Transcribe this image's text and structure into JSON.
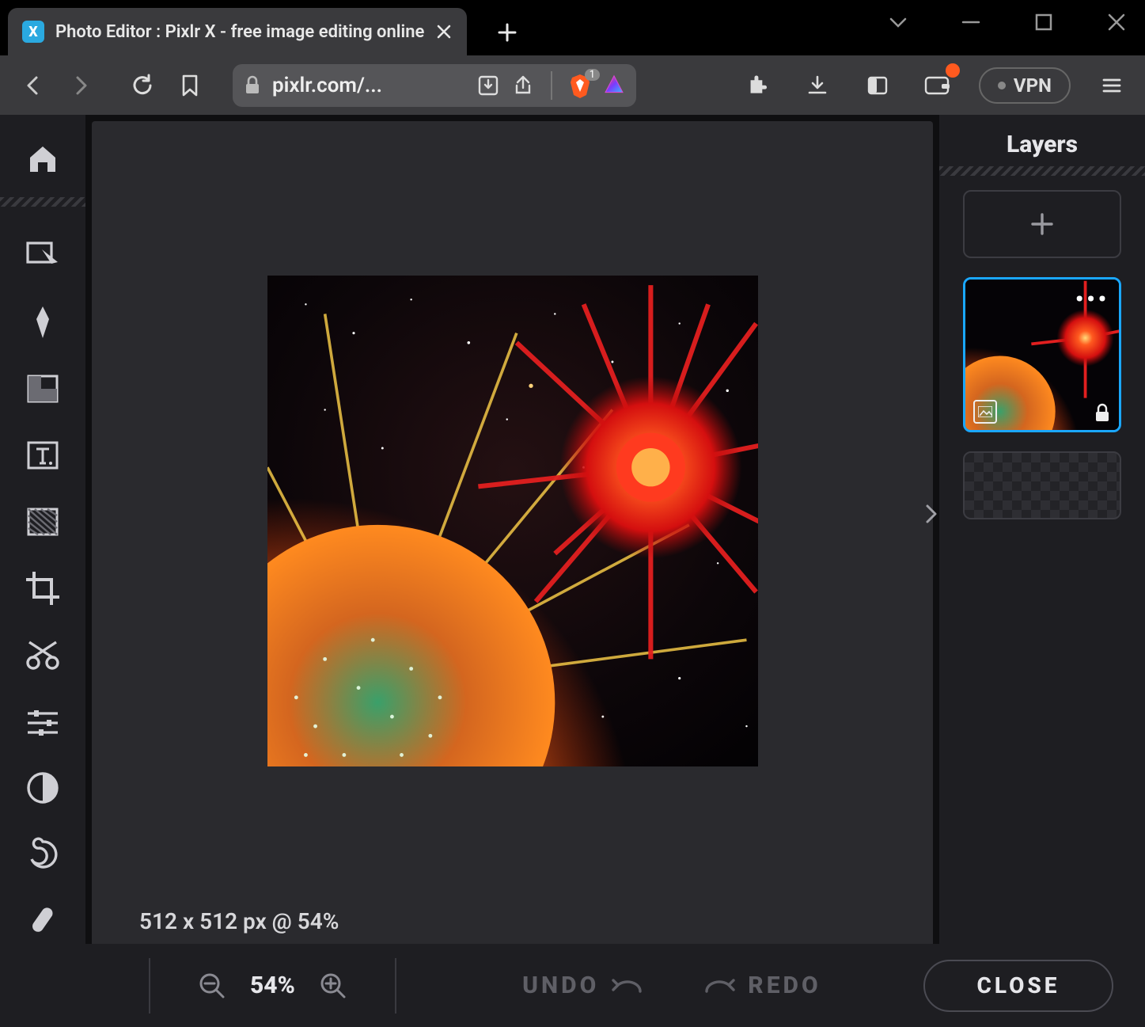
{
  "browser": {
    "tab_title": "Photo Editor : Pixlr X - free image editing online",
    "url_display": "pixlr.com/...",
    "vpn_label": "VPN",
    "brave_badge": "1"
  },
  "app": {
    "layers_title": "Layers",
    "status_text": "512 x 512 px @ 54%"
  },
  "bottom": {
    "zoom_pct": "54%",
    "undo_label": "UNDO",
    "redo_label": "REDO",
    "close_label": "CLOSE"
  }
}
